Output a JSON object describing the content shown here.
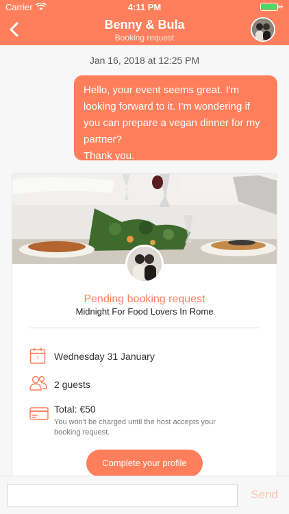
{
  "status_bar": {
    "carrier": "Carrier",
    "time": "4:11 PM"
  },
  "header": {
    "title": "Benny & Bula",
    "subtitle": "Booking request"
  },
  "conversation": {
    "timestamp": "Jan 16, 2018 at 12:25 PM",
    "message": "Hello, your event seems great. I'm looking forward to it. I'm wondering if you can prepare a vegan dinner for my partner?\nThank you."
  },
  "booking": {
    "status": "Pending booking request",
    "event_title": "Midnight For Food Lovers In Rome",
    "date": "Wednesday 31 January",
    "guests": "2 guests",
    "total": "Total: €50",
    "total_note": "You won't be charged until the host accepts your\nbooking request.",
    "cta": "Complete your profile"
  },
  "composer": {
    "placeholder": "",
    "send": "Send"
  },
  "colors": {
    "accent": "#ff7f5c"
  },
  "icons": [
    "back-icon",
    "wifi-icon",
    "battery-icon",
    "calendar-icon",
    "guests-icon",
    "credit-card-icon"
  ]
}
